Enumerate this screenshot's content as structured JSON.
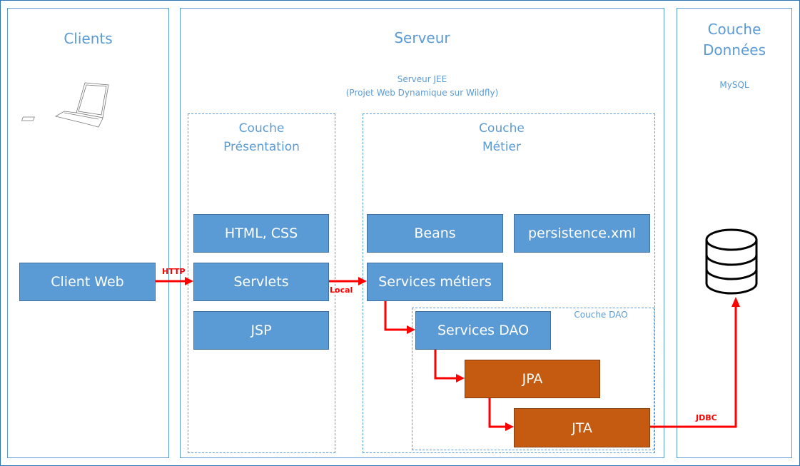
{
  "columns": {
    "clients": "Clients",
    "serveur": "Serveur",
    "donnees_line1": "Couche",
    "donnees_line2": "Données"
  },
  "serveur_subtitle_line1": "Serveur JEE",
  "serveur_subtitle_line2": "(Projet Web Dynamique sur Wildfly)",
  "donnees_subtitle": "MySQL",
  "layers": {
    "presentation_line1": "Couche",
    "presentation_line2": "Présentation",
    "metier_line1": "Couche",
    "metier_line2": "Métier",
    "dao": "Couche DAO"
  },
  "boxes": {
    "client_web": "Client Web",
    "html_css": "HTML, CSS",
    "servlets": "Servlets",
    "jsp": "JSP",
    "beans": "Beans",
    "persistence": "persistence.xml",
    "services_metiers": "Services métiers",
    "services_dao": "Services DAO",
    "jpa": "JPA",
    "jta": "JTA"
  },
  "connectors": {
    "http": "HTTP",
    "local": "Local",
    "jdbc": "JDBC"
  },
  "colors": {
    "blue": "#5B9BD5",
    "orange": "#C55A11",
    "arrow": "#FF0000"
  },
  "icons": [
    "laptop-icon",
    "database-icon"
  ]
}
